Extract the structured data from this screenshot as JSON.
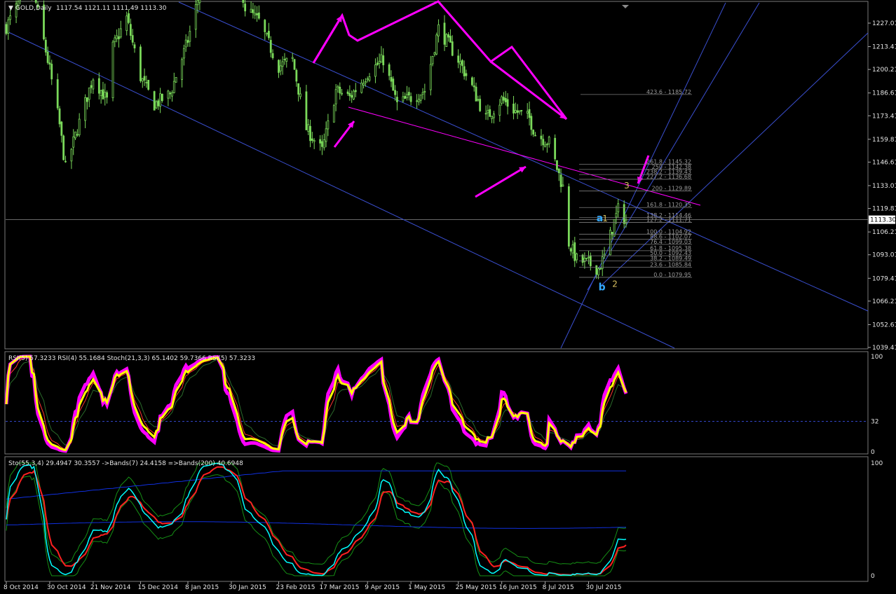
{
  "chart_data": {
    "type": "candlestick",
    "symbol": "GOLD",
    "timeframe": "Daily",
    "header": {
      "symbol_tf": "GOLD,Daily",
      "ohlc": "1117.54 1121.11 1111.49 1113.30"
    },
    "current_price": 1113.3,
    "current_price_label": "1113.30",
    "price_axis": {
      "min": 1039.41,
      "max": 1240.6,
      "ticks": [
        "1227.01",
        "1213.41",
        "1200.21",
        "1186.61",
        "1173.41",
        "1159.81",
        "1146.61",
        "1133.01",
        "1119.81",
        "1106.21",
        "1093.01",
        "1079.41",
        "1066.21",
        "1052.61",
        "1039.41"
      ]
    },
    "date_axis": {
      "labels": [
        "8 Oct 2014",
        "30 Oct 2014",
        "21 Nov 2014",
        "15 Dec 2014",
        "8 Jan 2015",
        "30 Jan 2015",
        "23 Feb 2015",
        "17 Mar 2015",
        "9 Apr 2015",
        "1 May 2015",
        "25 May 2015",
        "16 Jun 2015",
        "8 Jul 2015",
        "30 Jul 2015"
      ]
    },
    "price_path": [
      [
        "8 Oct 2014",
        1225
      ],
      [
        "15 Oct 2014",
        1240
      ],
      [
        "22 Oct 2014",
        1244
      ],
      [
        "30 Oct 2014",
        1200
      ],
      [
        "4 Nov 2014",
        1168
      ],
      [
        "7 Nov 2014",
        1143
      ],
      [
        "12 Nov 2014",
        1162
      ],
      [
        "21 Nov 2014",
        1196
      ],
      [
        "28 Nov 2014",
        1182
      ],
      [
        "1 Dec 2014",
        1213
      ],
      [
        "8 Dec 2014",
        1230
      ],
      [
        "15 Dec 2014",
        1196
      ],
      [
        "22 Dec 2014",
        1180
      ],
      [
        "30 Dec 2014",
        1186
      ],
      [
        "8 Jan 2015",
        1217
      ],
      [
        "15 Jan 2015",
        1250
      ],
      [
        "22 Jan 2015",
        1296
      ],
      [
        "30 Jan 2015",
        1282
      ],
      [
        "6 Feb 2015",
        1236
      ],
      [
        "13 Feb 2015",
        1228
      ],
      [
        "23 Feb 2015",
        1202
      ],
      [
        "2 Mar 2015",
        1206
      ],
      [
        "9 Mar 2015",
        1166
      ],
      [
        "17 Mar 2015",
        1153
      ],
      [
        "24 Mar 2015",
        1188
      ],
      [
        "31 Mar 2015",
        1184
      ],
      [
        "9 Apr 2015",
        1198
      ],
      [
        "17 Apr 2015",
        1206
      ],
      [
        "24 Apr 2015",
        1180
      ],
      [
        "1 May 2015",
        1184
      ],
      [
        "8 May 2015",
        1188
      ],
      [
        "15 May 2015",
        1224
      ],
      [
        "25 May 2015",
        1206
      ],
      [
        "1 Jun 2015",
        1190
      ],
      [
        "8 Jun 2015",
        1172
      ],
      [
        "16 Jun 2015",
        1183
      ],
      [
        "23 Jun 2015",
        1176
      ],
      [
        "30 Jun 2015",
        1172
      ],
      [
        "3 Jul 2015",
        1163
      ],
      [
        "10 Jul 2015",
        1158
      ],
      [
        "17 Jul 2015",
        1132
      ],
      [
        "20 Jul 2015",
        1100
      ],
      [
        "24 Jul 2015",
        1090
      ],
      [
        "30 Jul 2015",
        1088
      ],
      [
        "4 Aug 2015",
        1085
      ],
      [
        "7 Aug 2015",
        1092
      ],
      [
        "12 Aug 2015",
        1112
      ],
      [
        "14 Aug 2015",
        1119
      ],
      [
        "18 Aug 2015",
        1113
      ]
    ],
    "fib_levels": [
      {
        "label": "423.6 - 1185.72",
        "value": 1185.72
      },
      {
        "label": "261.8 - 1145.32",
        "value": 1145.32
      },
      {
        "label": "250 - 1142.38",
        "value": 1142.38
      },
      {
        "label": "238.2 - 1139.43",
        "value": 1139.43
      },
      {
        "label": "227.2 - 1136.68",
        "value": 1136.68
      },
      {
        "label": "200 - 1129.89",
        "value": 1129.89
      },
      {
        "label": "161.8 - 1120.35",
        "value": 1120.35
      },
      {
        "label": "138.2 - 1114.46",
        "value": 1114.46
      },
      {
        "label": "127.2 - 1111.71",
        "value": 1111.71
      },
      {
        "label": "100.0 - 1104.92",
        "value": 1104.92
      },
      {
        "label": "88.6 - 1102.07",
        "value": 1102.07
      },
      {
        "label": "76.4 - 1099.03",
        "value": 1099.03
      },
      {
        "label": "61.8 - 1095.38",
        "value": 1095.38
      },
      {
        "label": "50.0 - 1092.43",
        "value": 1092.43
      },
      {
        "label": "38.2 - 1089.49",
        "value": 1089.49
      },
      {
        "label": "23.6 - 1085.84",
        "value": 1085.84
      },
      {
        "label": "0.0 - 1079.95",
        "value": 1079.95
      }
    ],
    "wave_labels": [
      {
        "text": "a",
        "date": "3 Aug 2015",
        "price": 1114,
        "color": "#33aaff"
      },
      {
        "text": "b",
        "date": "4 Aug 2015",
        "price": 1074,
        "color": "#33aaff"
      },
      {
        "text": "1",
        "date": "6 Aug 2015",
        "price": 1114,
        "color": "#d8c060"
      },
      {
        "text": "2",
        "date": "11 Aug 2015",
        "price": 1076,
        "color": "#d8c060"
      },
      {
        "text": "3",
        "date": "17 Aug 2015",
        "price": 1133,
        "color": "#d8c060"
      }
    ],
    "rsi_panel": {
      "label": "RSI(5) 57.3233  RSI(4) 55.1684  Stoch(21,3,3) 65.1402 59.7366  RSI(5) 57.3233",
      "range": [
        0,
        100
      ],
      "ticks": [
        "100",
        "32",
        "0"
      ],
      "level": 32
    },
    "sto_panel": {
      "label": "Sto(55,3,4) 29.4947 30.3557  ->Bands(7) 24.4158  =>Bands(200) 40.6948",
      "range": [
        0,
        100
      ],
      "ticks": [
        "100",
        "0"
      ]
    },
    "colors": {
      "candle": "#7ad95a",
      "grid_line": "#4d5e9a",
      "trend_line": "#3a4fd0",
      "magenta": "#ff00ff",
      "fib": "#7d7d7d",
      "rsi_main": "#ffff00",
      "rsi_outline": "#ff00ff",
      "rsi_signal": "#ff3030",
      "sto_main": "#00ffff",
      "sto_signal": "#ff2020",
      "bands": "#1030e0",
      "fast_bands": "#159015"
    }
  }
}
